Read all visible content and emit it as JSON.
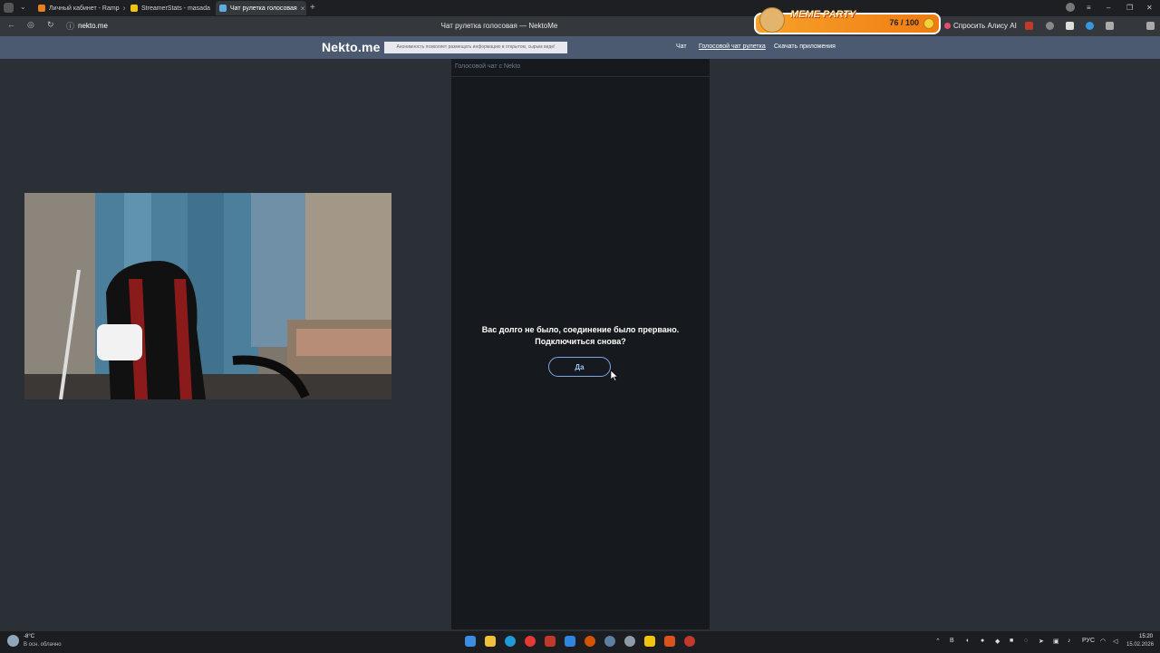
{
  "browser": {
    "tabs": [
      {
        "label": "Личный кабинет - Ramp"
      },
      {
        "label": "StreamerStats - masada"
      },
      {
        "label": "Чат рулетка голосовая"
      }
    ],
    "window_title": "Чат рулетка голосовая — NektoMe",
    "url": "nekto.me",
    "meme_party": {
      "title": "MEME PARTY",
      "progress": "76 / 100"
    },
    "alice_label": "Спросить Алису AI"
  },
  "site": {
    "logo": "Nekto.me",
    "notice": "Анонимность позволяет размещать информацию в открытом, сырым виде!",
    "nav": {
      "chat": "Чат",
      "voice": "Голосовой чат рулетка",
      "apps": "Скачать приложения"
    },
    "panel_title": "Голосовой чат с Nekto",
    "disconnect_line1": "Вас долго не было, соединение было прервано.",
    "disconnect_line2": "Подключиться снова?",
    "yes_button": "Да"
  },
  "taskbar": {
    "weather_temp": "-8°C",
    "weather_desc": "В осн. облачно",
    "lang": "РУС",
    "time": "15:20",
    "date": "15.02.2026"
  },
  "colors": {
    "header": "#4b5a70",
    "page_bg": "#2b3036",
    "panel_bg": "#16191d",
    "button_border": "#7ba9e6"
  }
}
